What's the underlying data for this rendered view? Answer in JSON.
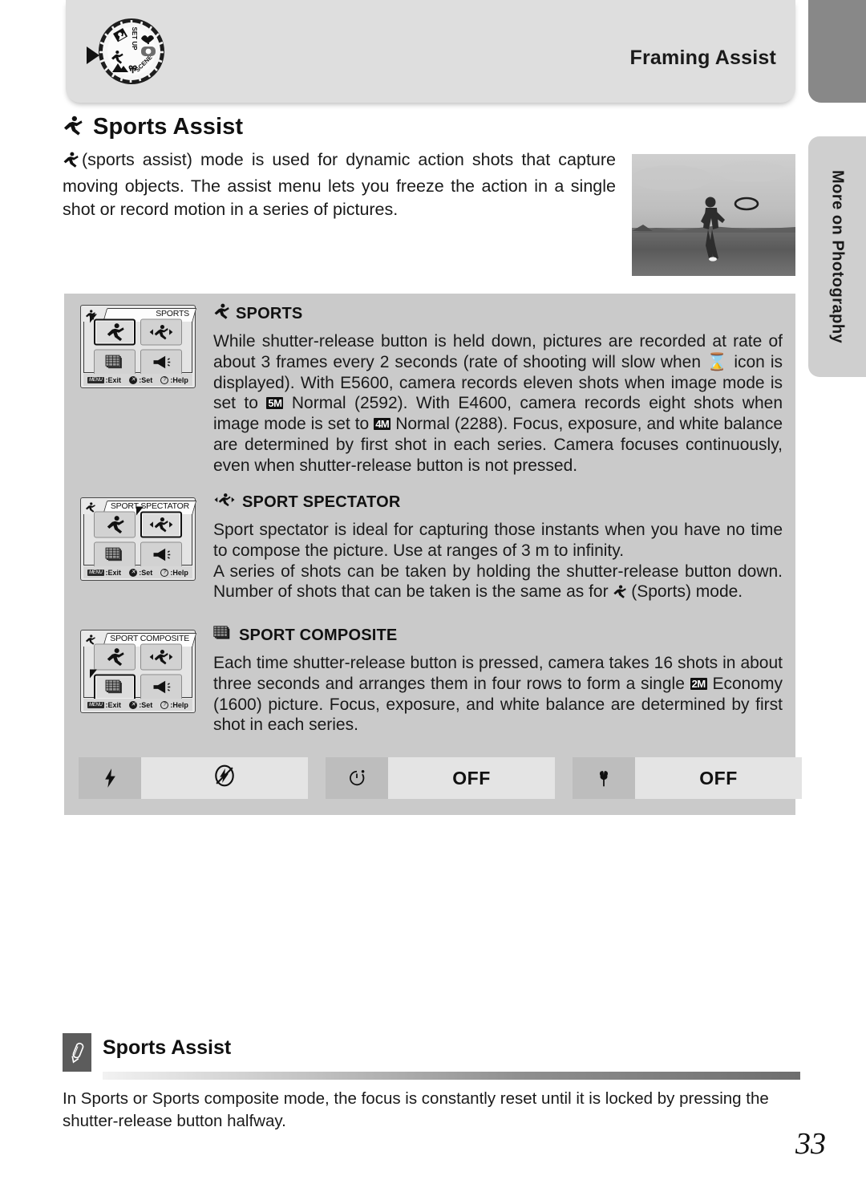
{
  "header": {
    "title": "Framing Assist",
    "dial_icon": "mode-dial-icon",
    "dial_labels": [
      "SET UP",
      "SCENE"
    ]
  },
  "side_tab": {
    "label": "More on Photography"
  },
  "page": {
    "title": "Sports Assist",
    "title_icon": "running-person-icon",
    "number": "33"
  },
  "intro": {
    "icon": "running-person-icon",
    "text": "(sports assist) mode is used for dynamic action shots that capture moving objects. The assist menu lets you freeze the action in a single shot or record motion in a series of pictures."
  },
  "hero_photo": {
    "alt": "woman running in a field throwing a flying disc"
  },
  "lcd_screens": [
    {
      "tab_icon": "running-person-icon",
      "tab_name": "SPORTS",
      "selected_index": 0,
      "cells": [
        "sports-icon",
        "sport-spectator-icon",
        "sport-composite-icon",
        "sports-museum-icon"
      ],
      "footer": [
        {
          "key": "MENU",
          "label": ":Exit"
        },
        {
          "key": "✕",
          "label": ":Set"
        },
        {
          "key": "?",
          "label": ":Help"
        }
      ]
    },
    {
      "tab_icon": "running-person-icon",
      "tab_name": "SPORT SPECTATOR",
      "selected_index": 1,
      "cells": [
        "sports-icon",
        "sport-spectator-icon",
        "sport-composite-icon",
        "sports-museum-icon"
      ],
      "footer": [
        {
          "key": "MENU",
          "label": ":Exit"
        },
        {
          "key": "✕",
          "label": ":Set"
        },
        {
          "key": "?",
          "label": ":Help"
        }
      ]
    },
    {
      "tab_icon": "running-person-icon",
      "tab_name": "SPORT COMPOSITE",
      "selected_index": 2,
      "cells": [
        "sports-icon",
        "sport-spectator-icon",
        "sport-composite-icon",
        "sports-museum-icon"
      ],
      "footer": [
        {
          "key": "MENU",
          "label": ":Exit"
        },
        {
          "key": "✕",
          "label": ":Set"
        },
        {
          "key": "?",
          "label": ":Help"
        }
      ]
    }
  ],
  "sections": [
    {
      "icon": "running-person-icon",
      "heading": "SPORTS",
      "paragraphs": [
        "While shutter-release button is held down, pictures are recorded at rate of about 3 frames every 2 seconds (rate of shooting will slow when ⧖ icon is displayed). With E5600, camera records eleven shots when image mode is set to [5M] Normal (2592). With E4600, camera records eight shots when image mode is set to [4M] Normal (2288). Focus, exposure, and white balance are determined by first shot in each series. Camera focuses continuously, even when shutter-release button is not pressed."
      ]
    },
    {
      "icon": "sport-spectator-icon",
      "heading": "SPORT SPECTATOR",
      "paragraphs": [
        "Sport spectator is ideal for capturing those instants when you have no time to compose the picture. Use at ranges of 3 m to infinity.",
        "A series of shots can be taken by holding the shutter-release button down. Number of shots that can be taken is the same as for Ἴ3 (Sports) mode."
      ]
    },
    {
      "icon": "sport-composite-icon",
      "heading": "SPORT COMPOSITE",
      "paragraphs": [
        "Each time shutter-release button is pressed, camera takes 16 shots in about three seconds and arranges them in four rows to form a single [2M] Economy (1600) picture. Focus, exposure, and white balance are determined by first shot in each series."
      ]
    }
  ],
  "section_text": {
    "sports_p1_a": "While shutter-release button is held down, pictures are recorded at rate of about 3 frames every 2 seconds (rate of shooting will slow when ",
    "sports_p1_b": " icon is displayed). With E5600, camera records eleven shots when image mode is set to ",
    "sports_chip_5m": "5M",
    "sports_p1_c": " Normal (2592). With E4600, camera records eight shots when image mode is set to ",
    "sports_chip_4m": "4M",
    "sports_p1_d": " Normal (2288). Focus, exposure, and white balance are determined by first shot in each series. Camera focuses continuously, even when shutter-release button is not pressed.",
    "spectator_p1": "Sport spectator is ideal for capturing those instants when you have no time to compose the picture. Use at ranges of 3 m to infinity.",
    "spectator_p2_a": "A series of shots can be taken by holding the shutter-release button down. Number of shots that can be taken is the same as for ",
    "spectator_p2_b": " (Sports) mode.",
    "composite_p1_a": "Each time shutter-release button is pressed, camera takes 16 shots in about three seconds and arranges them in four rows to form a single ",
    "composite_chip_2m": "2M",
    "composite_p1_b": " Economy (1600) picture. Focus, exposure, and white balance are determined by first shot in each series."
  },
  "settings_bar": [
    {
      "icon": "flash-icon",
      "value": "flash-off-icon",
      "value_is_icon": true
    },
    {
      "icon": "self-timer-icon",
      "value": "OFF",
      "value_is_icon": false
    },
    {
      "icon": "macro-flower-icon",
      "value": "OFF",
      "value_is_icon": false
    }
  ],
  "note": {
    "icon": "pencil-note-icon",
    "title": "Sports Assist",
    "body": "In Sports or Sports composite mode, the focus is constantly reset until it is locked by pressing the shutter-release button halfway."
  },
  "colors": {
    "header_band": "#dedede",
    "side_tab_top": "#888888",
    "side_tab_body": "#cfcfcf",
    "panel": "#cacaca",
    "lcd_bg": "#e4e4e4",
    "setting_icon_bg": "#bdbdbd",
    "setting_value_bg": "#e4e4e4",
    "note_icon_bg": "#5c5c5c"
  }
}
